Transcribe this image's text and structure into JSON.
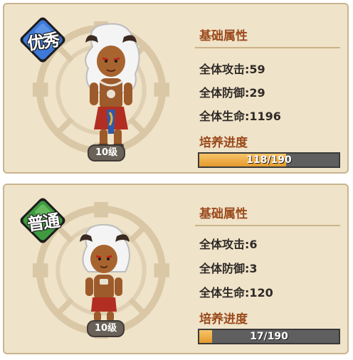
{
  "cards": [
    {
      "rarity": "优秀",
      "rarity_color": "#3e78d8",
      "level": "10级",
      "section_base": "基础属性",
      "stats": [
        {
          "label": "全体攻击",
          "value": "59",
          "text": "全体攻击:59"
        },
        {
          "label": "全体防御",
          "value": "29",
          "text": "全体防御:29"
        },
        {
          "label": "全体生命",
          "value": "1196",
          "text": "全体生命:1196"
        }
      ],
      "section_progress": "培养进度",
      "progress": {
        "current": 118,
        "max": 190,
        "text": "118/190"
      }
    },
    {
      "rarity": "普通",
      "rarity_color": "#3f9a3f",
      "level": "10级",
      "section_base": "基础属性",
      "stats": [
        {
          "label": "全体攻击",
          "value": "6",
          "text": "全体攻击:6"
        },
        {
          "label": "全体防御",
          "value": "3",
          "text": "全体防御:3"
        },
        {
          "label": "全体生命",
          "value": "120",
          "text": "全体生命:120"
        }
      ],
      "section_progress": "培养进度",
      "progress": {
        "current": 17,
        "max": 190,
        "text": "17/190"
      }
    }
  ],
  "colors": {
    "card_bg": "#efe3c9",
    "title_text": "#9b4a1c",
    "stat_text": "#2f2a26",
    "progress_fill": "#e49a2c",
    "progress_track": "#5f5f5f"
  },
  "icons": {
    "rune_circle": "rune-circle-icon",
    "hero": "horned-warrior-icon"
  }
}
